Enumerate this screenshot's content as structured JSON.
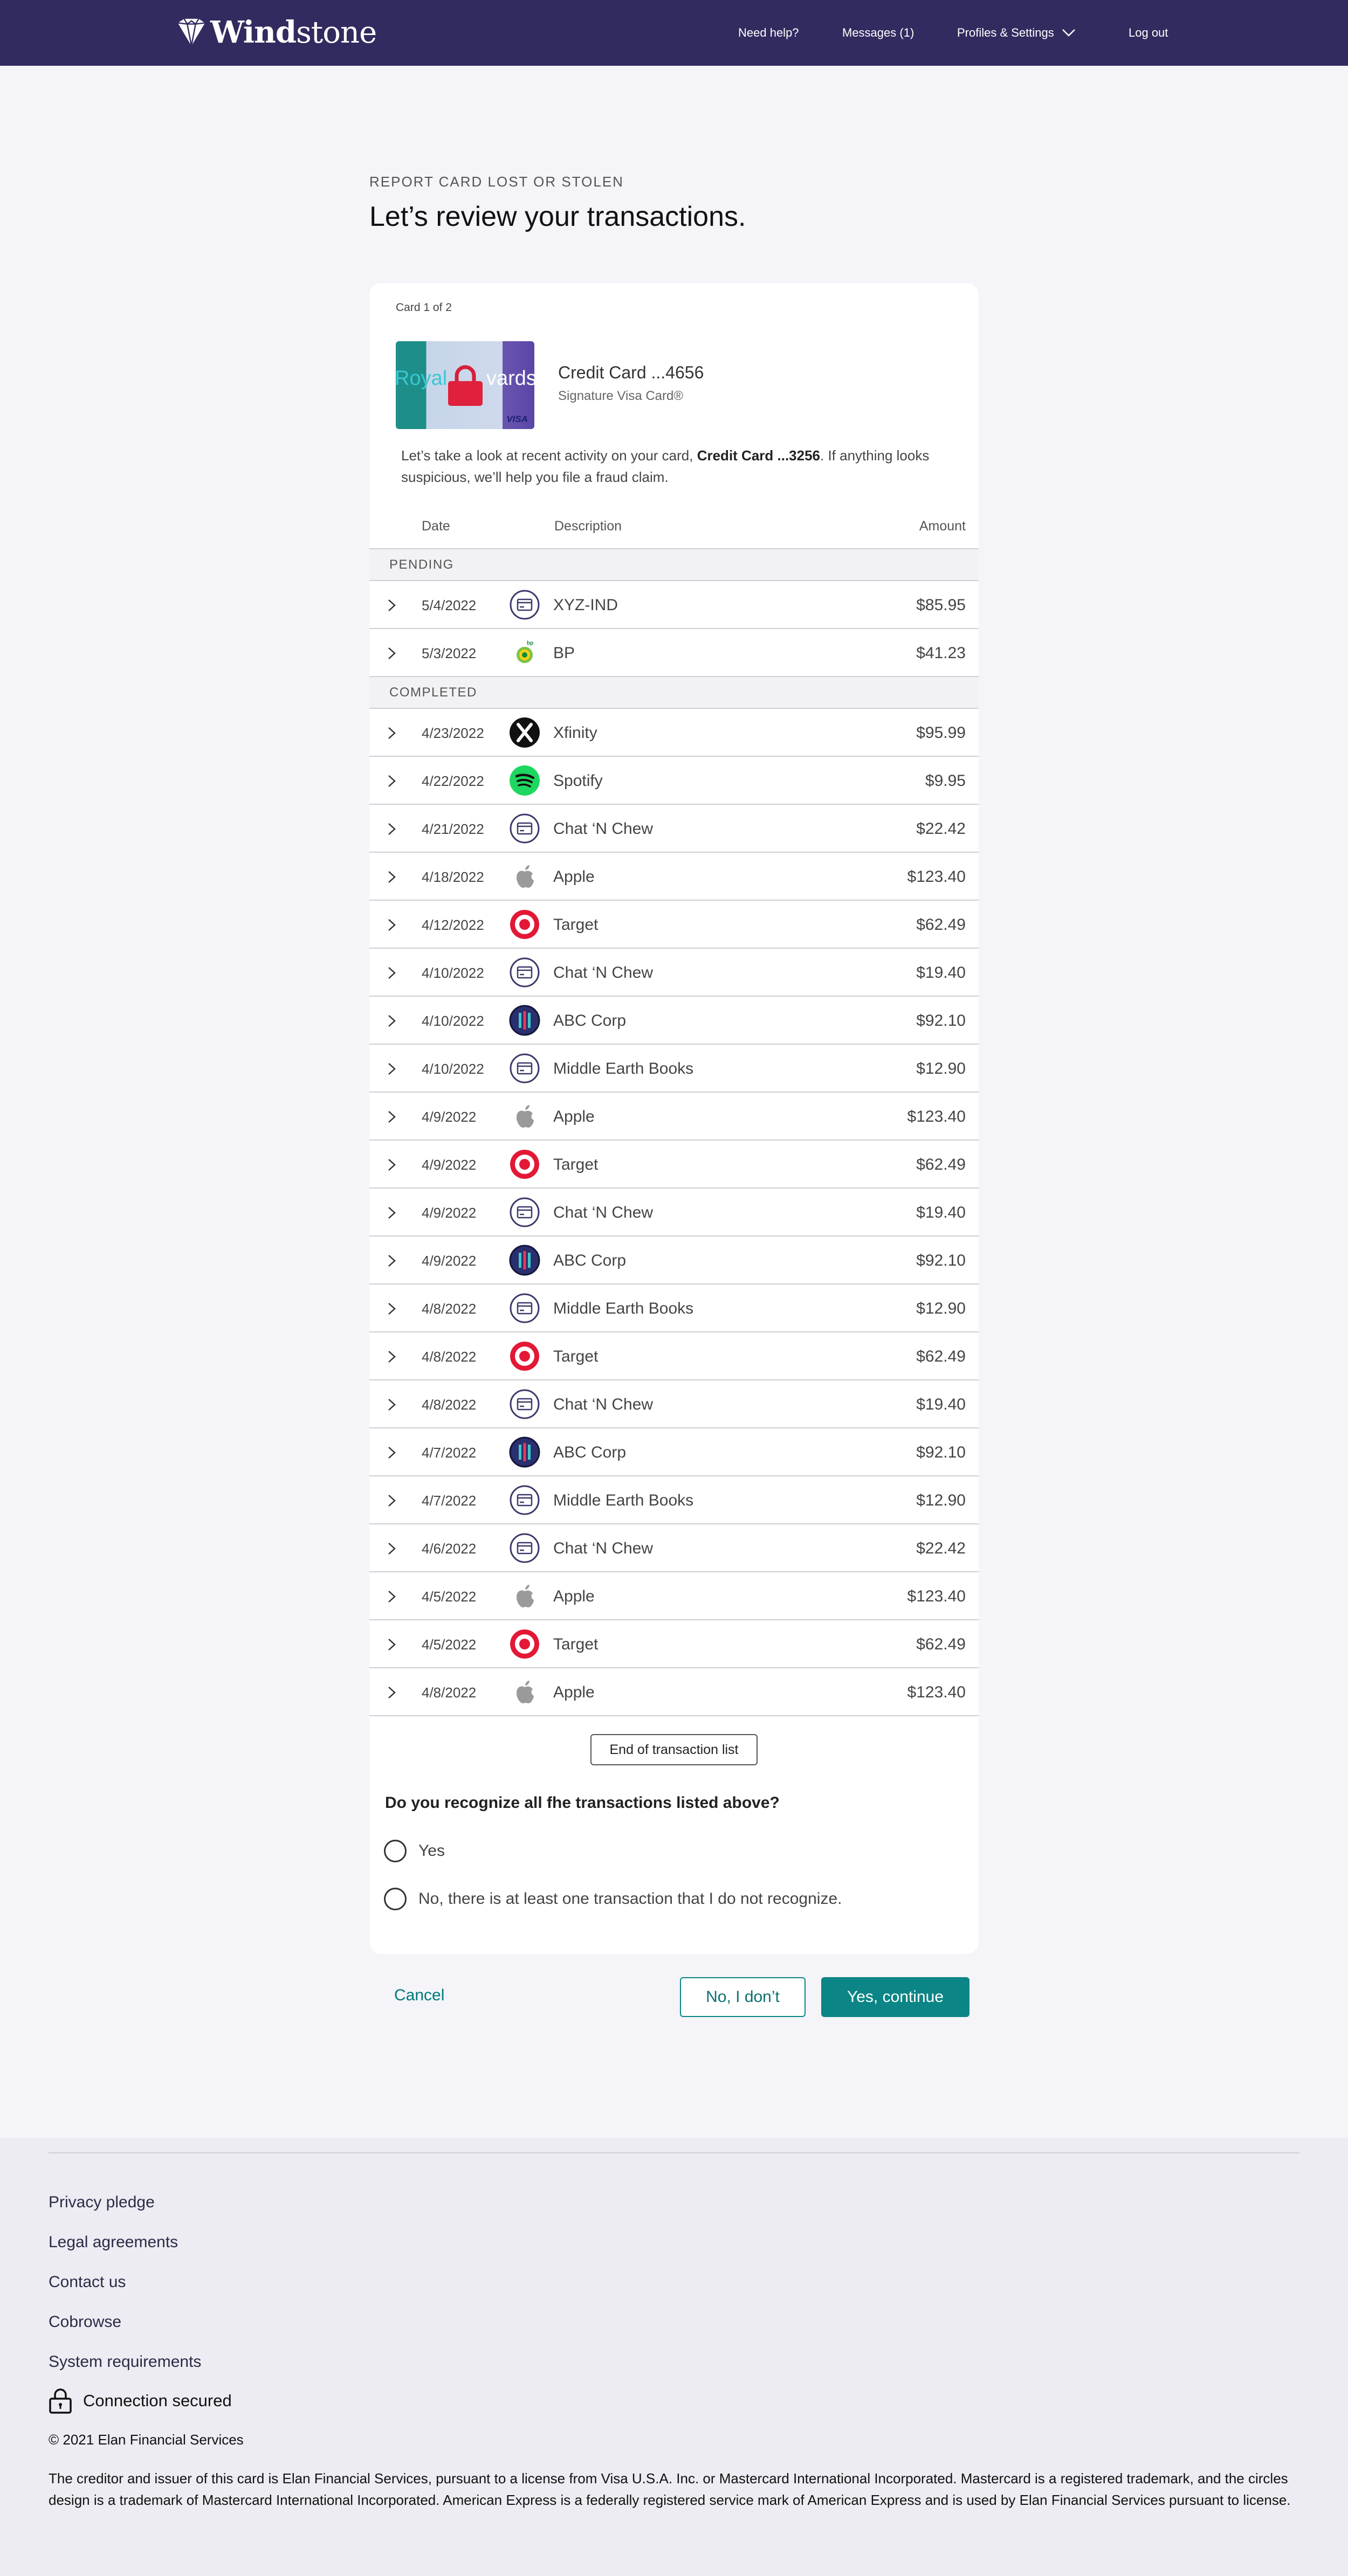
{
  "header": {
    "logo_bold": "Wind",
    "logo_rest": "stone",
    "nav": {
      "help": "Need help?",
      "messages": "Messages (1)",
      "profiles": "Profiles & Settings",
      "logout": "Log out"
    }
  },
  "page": {
    "eyebrow": "REPORT CARD LOST OR STOLEN",
    "title": "Let’s review your transactions."
  },
  "card": {
    "count": "Card 1 of 2",
    "image_text_left": "Royal",
    "image_text_right": "vards",
    "network": "VISA",
    "name": "Credit Card ...4656",
    "type": "Signature Visa Card®",
    "intro_before": "Let’s take a look at recent activity on your card, ",
    "intro_bold": "Credit Card ...3256",
    "intro_after": ". If anything looks suspicious, we’ll help you file a fraud claim."
  },
  "table": {
    "headers": {
      "date": "Date",
      "description": "Description",
      "amount": "Amount"
    },
    "pending_label": "PENDING",
    "completed_label": "COMPLETED",
    "pending": [
      {
        "date": "5/4/2022",
        "description": "XYZ-IND",
        "amount": "$85.95",
        "icon": "card-icon"
      },
      {
        "date": "5/3/2022",
        "description": "BP",
        "amount": "$41.23",
        "icon": "bp-logo-icon"
      }
    ],
    "completed": [
      {
        "date": "4/23/2022",
        "description": "Xfinity",
        "amount": "$95.99",
        "icon": "xfinity-logo-icon"
      },
      {
        "date": "4/22/2022",
        "description": "Spotify",
        "amount": "$9.95",
        "icon": "spotify-logo-icon"
      },
      {
        "date": "4/21/2022",
        "description": "Chat ‘N Chew",
        "amount": "$22.42",
        "icon": "card-icon"
      },
      {
        "date": "4/18/2022",
        "description": "Apple",
        "amount": "$123.40",
        "icon": "apple-logo-icon"
      },
      {
        "date": "4/12/2022",
        "description": "Target",
        "amount": "$62.49",
        "icon": "target-logo-icon"
      },
      {
        "date": "4/10/2022",
        "description": "Chat ‘N Chew",
        "amount": "$19.40",
        "icon": "card-icon"
      },
      {
        "date": "4/10/2022",
        "description": "ABC Corp",
        "amount": "$92.10",
        "icon": "abc-corp-logo-icon"
      },
      {
        "date": "4/10/2022",
        "description": "Middle Earth Books",
        "amount": "$12.90",
        "icon": "card-icon"
      },
      {
        "date": "4/9/2022",
        "description": "Apple",
        "amount": "$123.40",
        "icon": "apple-logo-icon"
      },
      {
        "date": "4/9/2022",
        "description": "Target",
        "amount": "$62.49",
        "icon": "target-logo-icon"
      },
      {
        "date": "4/9/2022",
        "description": "Chat ‘N Chew",
        "amount": "$19.40",
        "icon": "card-icon"
      },
      {
        "date": "4/9/2022",
        "description": "ABC Corp",
        "amount": "$92.10",
        "icon": "abc-corp-logo-icon"
      },
      {
        "date": "4/8/2022",
        "description": "Middle Earth Books",
        "amount": "$12.90",
        "icon": "card-icon"
      },
      {
        "date": "4/8/2022",
        "description": "Target",
        "amount": "$62.49",
        "icon": "target-logo-icon"
      },
      {
        "date": "4/8/2022",
        "description": "Chat ‘N Chew",
        "amount": "$19.40",
        "icon": "card-icon"
      },
      {
        "date": "4/7/2022",
        "description": "ABC Corp",
        "amount": "$92.10",
        "icon": "abc-corp-logo-icon"
      },
      {
        "date": "4/7/2022",
        "description": "Middle Earth Books",
        "amount": "$12.90",
        "icon": "card-icon"
      },
      {
        "date": "4/6/2022",
        "description": "Chat ‘N Chew",
        "amount": "$22.42",
        "icon": "card-icon"
      },
      {
        "date": "4/5/2022",
        "description": "Apple",
        "amount": "$123.40",
        "icon": "apple-logo-icon"
      },
      {
        "date": "4/5/2022",
        "description": "Target",
        "amount": "$62.49",
        "icon": "target-logo-icon"
      },
      {
        "date": "4/8/2022",
        "description": "Apple",
        "amount": "$123.40",
        "icon": "apple-logo-icon"
      }
    ],
    "end_label": "End of transaction list"
  },
  "question": {
    "text": "Do you recognize all fhe transactions listed above?",
    "yes": "Yes",
    "no": "No, there is at least one transaction that I do not recognize."
  },
  "actions": {
    "cancel": "Cancel",
    "no": "No, I don’t",
    "yes": "Yes, continue"
  },
  "footer": {
    "links": [
      "Privacy pledge",
      "Legal agreements",
      "Contact us",
      "Cobrowse",
      "System requirements"
    ],
    "secured": "Connection secured",
    "copyright": "© 2021 Elan Financial Services",
    "legal": "The creditor and issuer of this card is Elan Financial Services, pursuant to a license from Visa U.S.A. Inc. or Mastercard International Incorporated. Mastercard is a registered trademark, and the circles design is a trademark of Mastercard International Incorporated. American Express is a federally registered service mark of American Express and is used by Elan Financial Services pursuant to license."
  },
  "colors": {
    "header_bg": "#322b5f",
    "accent": "#0b8585",
    "page_bg": "#f4f4f9",
    "footer_bg": "#ececf2"
  }
}
